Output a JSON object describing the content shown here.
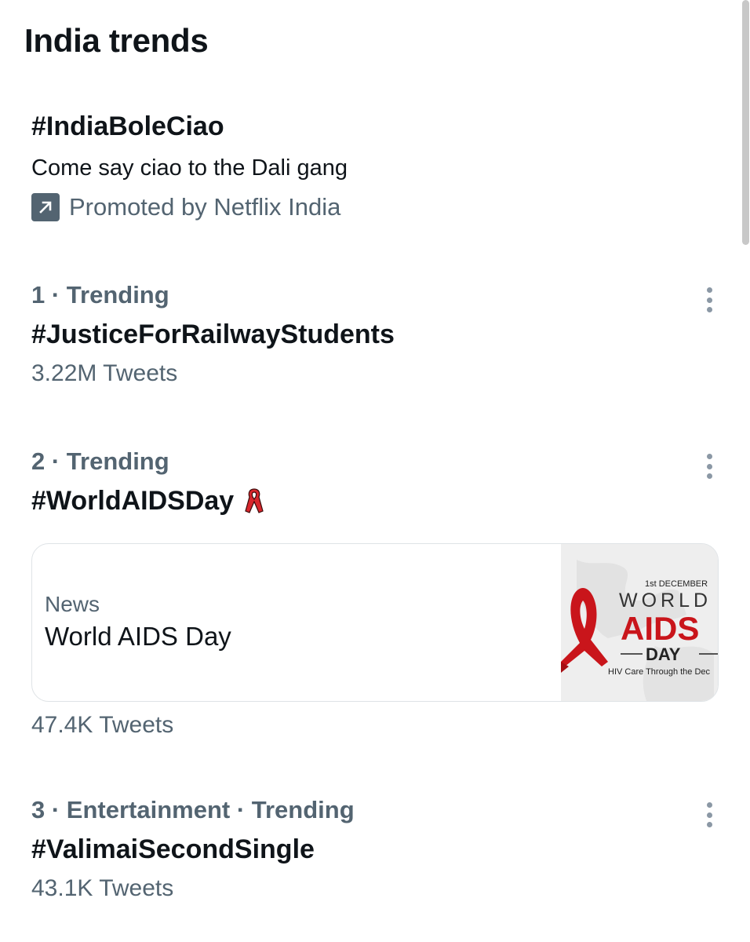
{
  "header": {
    "title": "India trends"
  },
  "promoted": {
    "hashtag": "#IndiaBoleCiao",
    "description": "Come say ciao to the Dali gang",
    "promoted_by": "Promoted by Netflix India",
    "icon": "arrow-up-right-icon"
  },
  "trends": [
    {
      "meta": "1 · Trending",
      "hashtag": "#JusticeForRailwayStudents",
      "count": "3.22M Tweets"
    },
    {
      "meta": "2 · Trending",
      "hashtag": "#WorldAIDSDay",
      "emoji": "red-ribbon-icon",
      "news": {
        "label": "News",
        "title": "World AIDS Day",
        "thumbnail": {
          "date": "1st DECEMBER",
          "line1": "WORLD",
          "line2": "AIDS",
          "line3": "DAY",
          "caption": "HIV Care Through the Dec"
        }
      },
      "count": "47.4K Tweets"
    },
    {
      "meta": "3 · Entertainment · Trending",
      "hashtag": "#ValimaiSecondSingle",
      "count": "43.1K Tweets"
    }
  ],
  "colors": {
    "primary_text": "#0f1419",
    "secondary_text": "#536471",
    "ribbon_red": "#d8262c"
  }
}
